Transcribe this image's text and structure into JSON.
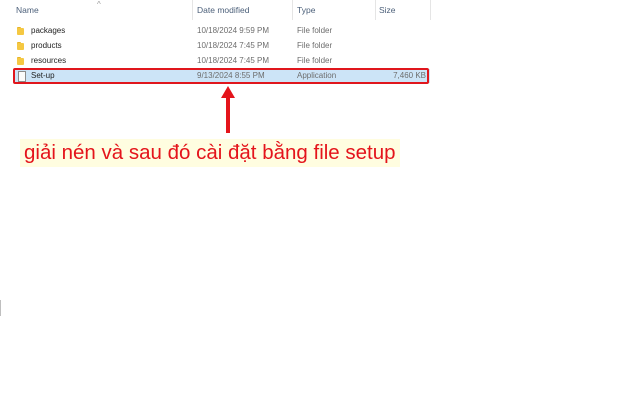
{
  "columns": {
    "name": "Name",
    "date_modified": "Date modified",
    "type": "Type",
    "size": "Size"
  },
  "files": [
    {
      "name": "packages",
      "date_modified": "10/18/2024 9:59 PM",
      "type": "File folder",
      "size": "",
      "icon": "folder-icon"
    },
    {
      "name": "products",
      "date_modified": "10/18/2024 7:45 PM",
      "type": "File folder",
      "size": "",
      "icon": "folder-icon"
    },
    {
      "name": "resources",
      "date_modified": "10/18/2024 7:45 PM",
      "type": "File folder",
      "size": "",
      "icon": "folder-icon"
    },
    {
      "name": "Set-up",
      "date_modified": "9/13/2024 8:55 PM",
      "type": "Application",
      "size": "7,460 KB",
      "icon": "application-icon",
      "selected": true
    }
  ],
  "annotation": {
    "text": "giải nén và sau đó cài đặt bằng file setup",
    "color": "#e4141b",
    "background": "#fffde0"
  },
  "colors": {
    "highlight_border": "#e0161d",
    "selection": "#cce4f7",
    "folder": "#f5c842"
  }
}
